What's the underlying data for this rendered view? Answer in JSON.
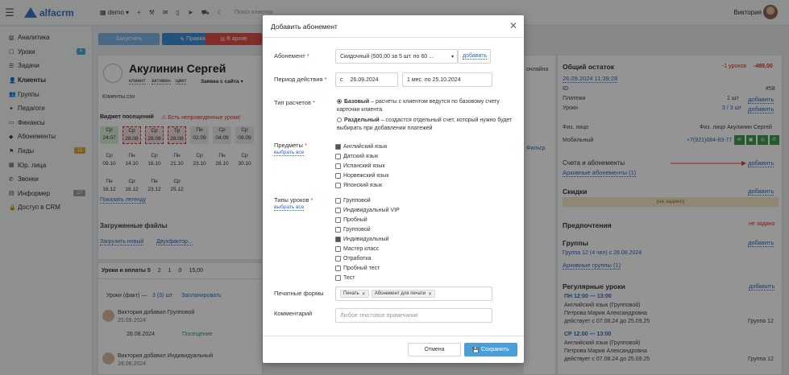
{
  "topbar": {
    "logo_text": "alfacrm",
    "branch": "demo",
    "search_placeholder": "Поиск клиента",
    "user_name": "Виктория"
  },
  "sidebar": {
    "items": [
      {
        "label": "Аналитика",
        "icon": "chart-icon"
      },
      {
        "label": "Уроки",
        "icon": "calendar-icon",
        "badge": "4"
      },
      {
        "label": "Задачи",
        "icon": "tasks-icon"
      },
      {
        "label": "Клиенты",
        "icon": "user-icon",
        "active": true
      },
      {
        "label": "Группы",
        "icon": "users-icon"
      },
      {
        "label": "Педагоги",
        "icon": "teacher-icon"
      },
      {
        "label": "Финансы",
        "icon": "money-icon"
      },
      {
        "label": "Абонементы",
        "icon": "tag-icon"
      },
      {
        "label": "Лиды",
        "icon": "funnel-icon",
        "badge": "11"
      },
      {
        "label": "Юр. лица",
        "icon": "building-icon"
      },
      {
        "label": "Звонки",
        "icon": "phone-icon"
      },
      {
        "label": "Информер",
        "icon": "bell-icon",
        "badge": "17"
      },
      {
        "label": "Доступ в CRM",
        "icon": "lock-icon"
      }
    ]
  },
  "client": {
    "name": "Акулинин Сергей",
    "tag_client": "клиент",
    "tag_active": "активен",
    "tag_color": "цвет",
    "request_select": "Заявка с сайта",
    "file": "Клиенты.csv",
    "btn_print": "Правка",
    "btn_archive": "В архив",
    "btn_schedule": "Запустить",
    "widget_title": "Виджет посещений",
    "widget_warning": "Есть непроведенные уроки!",
    "widget_filter": "Фильтр",
    "show_legend": "Показать легенду",
    "files_title": "Загруженные файлы",
    "upload_new": "Загрузить новый",
    "two_factor": "Двухфактор...",
    "tab_lessons": "Уроки и оплаты 5",
    "tab_2": "2",
    "tab_1": "1",
    "tab_0": "0",
    "tab_15": "15,00",
    "lessons_fact": "Уроки (факт) —",
    "lessons_fact_count": "3 (3) шт",
    "lessons_planned": "Запланировать",
    "feed": [
      {
        "author": "Виктория добавил Групповой",
        "subject": "— Английский язык",
        "date": "25.09.2024",
        "time": "11:52",
        "lesson_date": "28.08.2024",
        "duration": "60м",
        "status": "Посещение"
      },
      {
        "author": "Виктория добавил Индивидуальный",
        "subject": "— Английский язык",
        "date": "28.08.2024",
        "time": "14:50"
      }
    ]
  },
  "attendance": {
    "cells": [
      [
        "Ср 24.07",
        "Ср 28.08",
        "Ср 28.08",
        "Тр 28.08",
        "Пн 02.09",
        "Ср 04.09",
        "Ср 09.09"
      ],
      [
        "Ср 09.10",
        "Пн 14.10",
        "Ср 16.10",
        "Пн 21.10",
        "Ср 23.10",
        "Пн 28.10",
        "Ср 30.10"
      ],
      [
        "Пн 16.12",
        "Ср 18.12",
        "Пн 23.12",
        "Ср 25.12"
      ]
    ]
  },
  "right": {
    "balance_title": "Общий остаток",
    "balance_lessons": "-1 уроков",
    "balance_money": "-489,00",
    "balance_date": "26.09.2024 11:39:28",
    "id_label": "ID",
    "id_value": "#58",
    "payments_label": "Платежи",
    "payments_value": "1 шт",
    "add": "добавить",
    "lessons_label": "Уроки",
    "lessons_value": "3 / 3 шт",
    "person_label": "Физ. лицо",
    "person_value": "Физ. лицо Акулинин Сергей",
    "mobile_label": "Мобильный",
    "mobile_value": "+7(921)084-83-77",
    "accounts_title": "Счета и абонементы",
    "archive_subs": "Архивные абонементы (1)",
    "discounts_title": "Скидки",
    "not_set": "(не задано)",
    "prefs_title": "Предпочтения",
    "prefs_value": "не задано",
    "groups_title": "Группы",
    "group_value": "Группа 12 (4 чел) с 28.08.2024",
    "archive_groups": "Архивные группы (1)",
    "regular_title": "Регулярные уроки",
    "reg1_day": "ПН 12:00 — 13:00",
    "reg1_room": "Ауд6",
    "reg1_subject": "Английский язык (Групповой)",
    "reg1_teacher": "Петрова Мария Александровна",
    "reg1_valid": "действует с 07.08.24 до 25.09.25",
    "reg1_group": "Группа 12",
    "reg2_day": "СР 12:00 — 13:00",
    "reg2_room": "Ауд6",
    "reg2_subject": "Английский язык (Групповой)",
    "reg2_teacher": "Петрова Мария Александровна",
    "reg2_valid": "действует с 07.08.24 до 25.09.25",
    "reg2_group": "Группа 12",
    "online_label": "онлайна",
    "filter_label": "Фильтр"
  },
  "modal": {
    "title": "Добавить абонемент",
    "sub_label": "Абонемент",
    "sub_value": "Скидочный (500,00 за 5 шт. по 60 ...",
    "sub_add": "добавить",
    "period_label": "Период действия",
    "period_from_prefix": "с",
    "period_from": "26.09.2024",
    "period_to": "1 мес. по 25.10.2024",
    "calc_label": "Тип расчетов",
    "calc_basic_title": "Базовый",
    "calc_basic_desc": " – расчеты с клиентом ведутся по базовому счету карточки клиента",
    "calc_sep_title": "Раздельный",
    "calc_sep_desc": " – создастся отдельный счет, который нужно будет выбирать при добавлении платежей",
    "subjects_label": "Предметы",
    "select_all": "выбрать все",
    "subjects": [
      {
        "label": "Английский язык",
        "checked": true
      },
      {
        "label": "Датский язык",
        "checked": false
      },
      {
        "label": "Испанский язык",
        "checked": false
      },
      {
        "label": "Норвежский язык",
        "checked": false
      },
      {
        "label": "Японский язык",
        "checked": false
      }
    ],
    "types_label": "Типы уроков",
    "types": [
      {
        "label": "Групповой",
        "checked": false
      },
      {
        "label": "Индивидуальный VIP",
        "checked": false
      },
      {
        "label": "Пробный",
        "checked": false
      },
      {
        "label": "Групповой",
        "checked": false
      },
      {
        "label": "Индивидуальный",
        "checked": true
      },
      {
        "label": "Мастер класс",
        "checked": false
      },
      {
        "label": "Отработка",
        "checked": false
      },
      {
        "label": "Пробный тест",
        "checked": false
      },
      {
        "label": "Тест",
        "checked": false
      }
    ],
    "print_label": "Печатные формы",
    "print_chips": [
      "Печать",
      "Абонемент для печати"
    ],
    "comment_label": "Комментарий",
    "comment_placeholder": "Любое текстовое примечание",
    "cancel": "Отмена",
    "save": "Сохранить"
  },
  "colors": {
    "accent": "#3f74c9",
    "save": "#4a9fd8",
    "danger": "#d8342b",
    "success": "#3f9b4c"
  }
}
